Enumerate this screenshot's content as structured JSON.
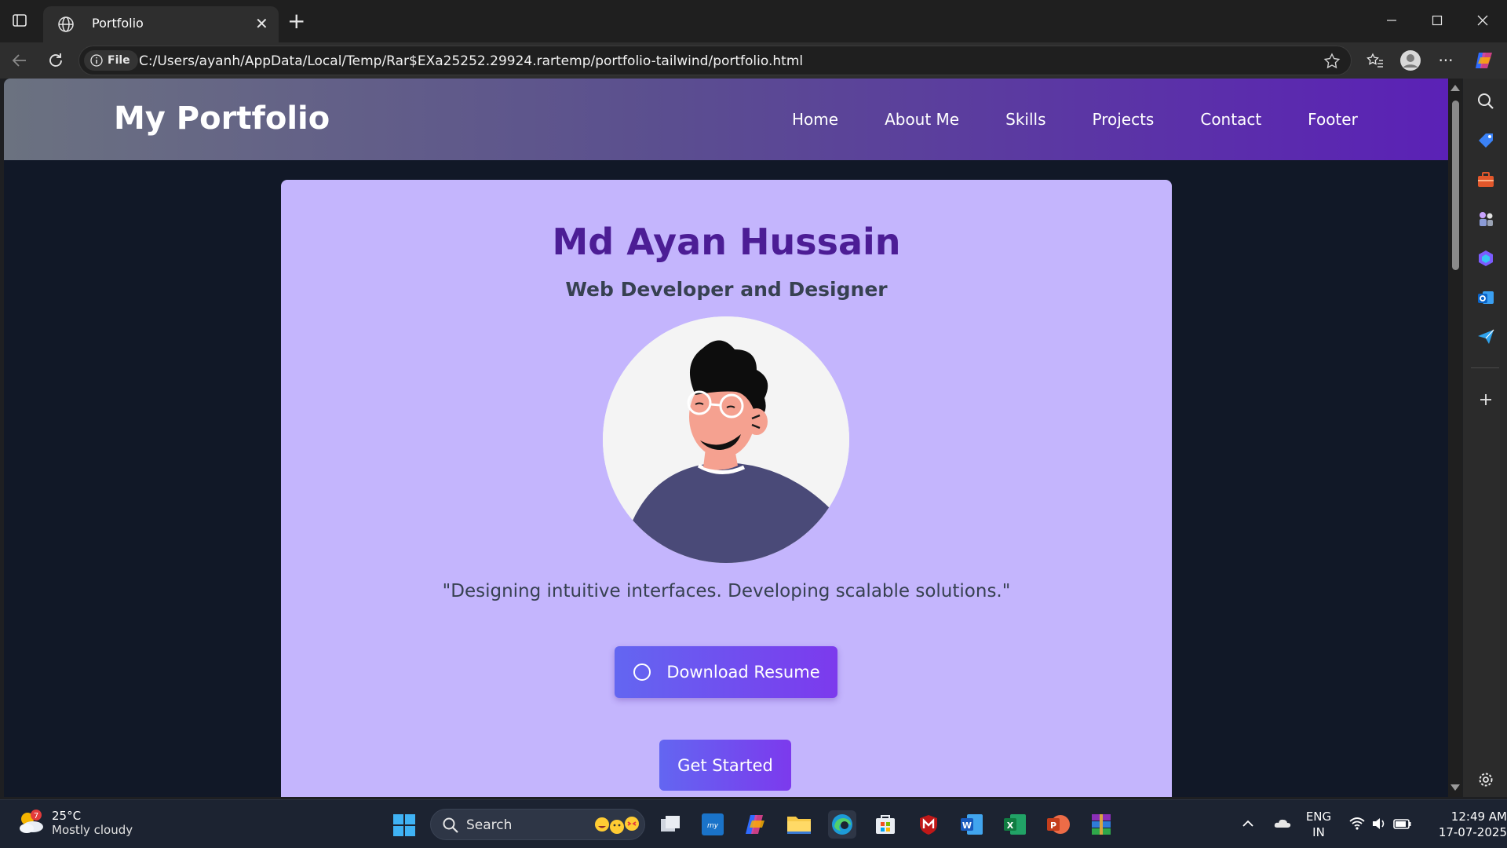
{
  "browser": {
    "tab_title": "Portfolio",
    "file_label": "File",
    "url": "C:/Users/ayanh/AppData/Local/Temp/Rar$EXa25252.29924.rartemp/portfolio-tailwind/portfolio.html"
  },
  "site": {
    "brand": "My Portfolio",
    "nav": [
      "Home",
      "About Me",
      "Skills",
      "Projects",
      "Contact",
      "Footer"
    ],
    "hero": {
      "name": "Md Ayan Hussain",
      "role": "Web Developer and Designer",
      "tagline": "\"Designing intuitive interfaces. Developing scalable solutions.\"",
      "resume_button": "Download Resume",
      "start_button": "Get Started"
    },
    "colors": {
      "header_gradient": [
        "#6b7280",
        "#5b21b6"
      ],
      "card_bg": "#c4b5fd",
      "name_color": "#4c1d95",
      "button_gradient": [
        "#6366f1",
        "#7c3aed"
      ],
      "page_bg": "#111827"
    }
  },
  "taskbar": {
    "weather_badge": "7",
    "weather_temp": "25°C",
    "weather_condition": "Mostly cloudy",
    "search_label": "Search",
    "apps": [
      "windows-start-icon",
      "search-icon",
      "task-view-icon",
      "mylp-icon",
      "copilot-icon",
      "file-explorer-icon",
      "edge-icon",
      "store-icon",
      "mcafee-icon",
      "word-icon",
      "excel-icon",
      "powerpoint-icon",
      "winrar-icon"
    ],
    "lang_top": "ENG",
    "lang_bottom": "IN",
    "time": "12:49 AM",
    "date": "17-07-2025"
  }
}
